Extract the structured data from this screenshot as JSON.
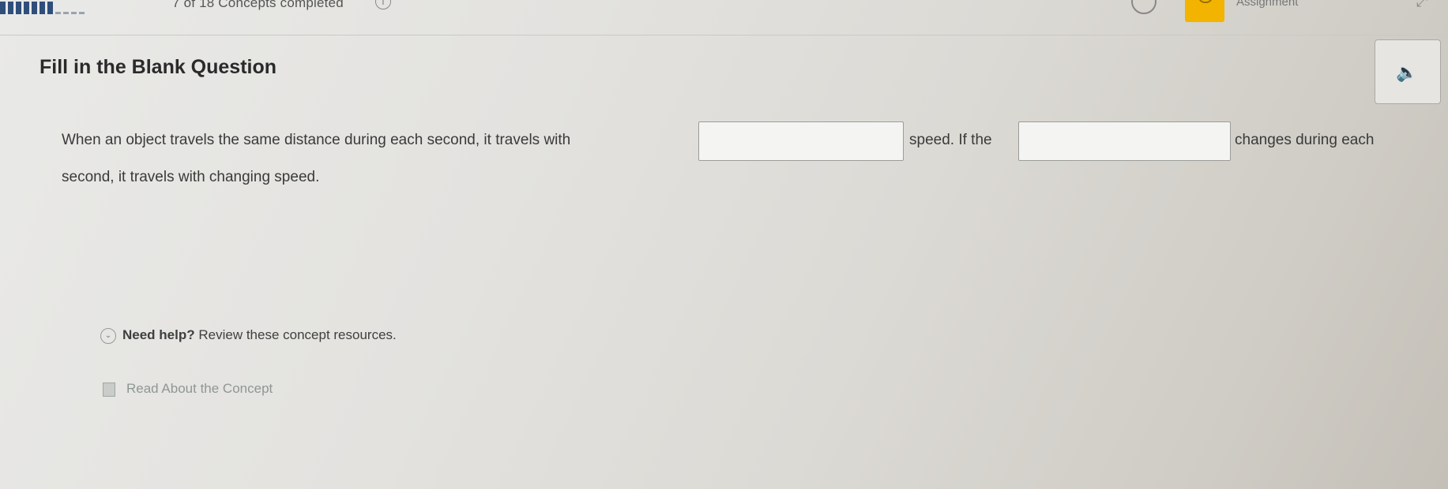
{
  "header": {
    "concepts_progress": "7 of 18 Concepts completed",
    "assignment_label": "Assignment"
  },
  "question": {
    "type_title": "Fill in the Blank Question",
    "prompt_part1": "When an object travels the same distance during each second, it travels with",
    "prompt_part2": "speed. If the",
    "prompt_part3": "changes during each",
    "prompt_part4": "second, it travels with changing speed.",
    "blank1_value": "",
    "blank2_value": ""
  },
  "help": {
    "prefix": "Need help?",
    "text": "Review these concept resources.",
    "resource_link": "Read About the Concept"
  },
  "icons": {
    "info": "info-icon",
    "audio": "speaker-icon",
    "expand": "expand-icon",
    "book": "book-icon",
    "chevron": "chevron-down-icon"
  }
}
